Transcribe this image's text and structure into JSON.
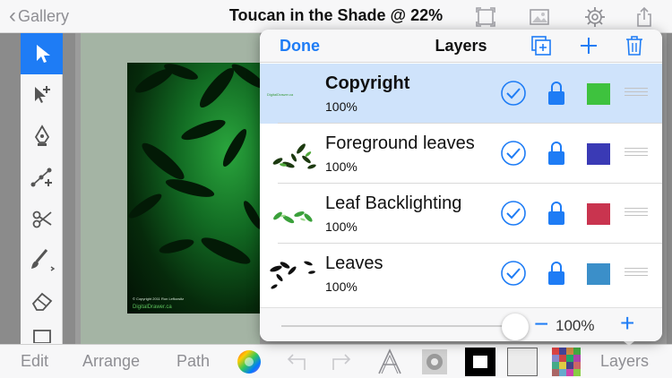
{
  "top": {
    "back_label": "Gallery",
    "title": "Toucan in the Shade @ 22%",
    "icons": [
      "fit-to-screen-icon",
      "image-icon",
      "gear-icon",
      "share-icon"
    ]
  },
  "tools": {
    "items": [
      "select-arrow-icon",
      "direct-select-icon",
      "pen-icon",
      "node-edit-icon",
      "scissors-icon",
      "brush-icon",
      "eraser-icon",
      "rectangle-icon"
    ],
    "active_index": 0
  },
  "artwork": {
    "copyright_small": "© Copyright 2011 Ron Lefkowitz",
    "site": "DigitalDrawer.ca"
  },
  "bottom": {
    "edit": "Edit",
    "arrange": "Arrange",
    "path": "Path",
    "layers": "Layers",
    "icons": [
      "color-wheel-icon",
      "undo-icon",
      "redo-icon",
      "text-tool-icon",
      "gear-pattern-icon",
      "stroke-color-icon",
      "fill-color-icon",
      "pattern-icon"
    ]
  },
  "layers_panel": {
    "done": "Done",
    "title": "Layers",
    "header_icons": [
      "duplicate-layer-icon",
      "add-layer-icon",
      "trash-icon"
    ],
    "thumb_text": "DigitalDrawer.ca",
    "layers": [
      {
        "name": "Copyright",
        "opacity": "100%",
        "color": "#3ec23e",
        "visible": true,
        "locked": true,
        "selected": true
      },
      {
        "name": "Foreground leaves",
        "opacity": "100%",
        "color": "#3a3ab5",
        "visible": true,
        "locked": true,
        "selected": false
      },
      {
        "name": "Leaf Backlighting",
        "opacity": "100%",
        "color": "#c9344f",
        "visible": true,
        "locked": true,
        "selected": false
      },
      {
        "name": "Leaves",
        "opacity": "100%",
        "color": "#3b8fc9",
        "visible": true,
        "locked": true,
        "selected": false
      }
    ],
    "opacity_value": "100%",
    "opacity_fraction": 1.0
  },
  "colors": {
    "accent": "#1e7cf5",
    "selected_row": "#cfe3fb"
  }
}
